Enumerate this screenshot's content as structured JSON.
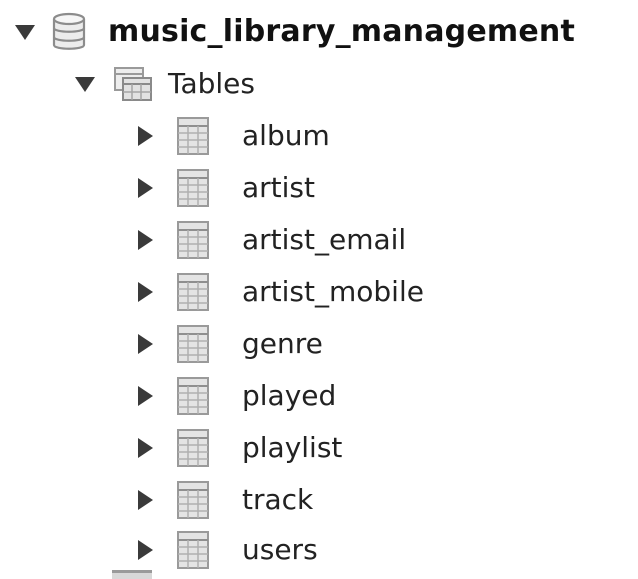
{
  "navigator": {
    "schema": {
      "name": "music_library_management",
      "icon": "database-icon",
      "expanded": true
    },
    "tables_folder": {
      "label": "Tables",
      "icon": "tables-folder-icon",
      "expanded": true
    },
    "tables": [
      {
        "label": "album",
        "icon": "table-icon",
        "expanded": false
      },
      {
        "label": "artist",
        "icon": "table-icon",
        "expanded": false
      },
      {
        "label": "artist_email",
        "icon": "table-icon",
        "expanded": false
      },
      {
        "label": "artist_mobile",
        "icon": "table-icon",
        "expanded": false
      },
      {
        "label": "genre",
        "icon": "table-icon",
        "expanded": false
      },
      {
        "label": "played",
        "icon": "table-icon",
        "expanded": false
      },
      {
        "label": "playlist",
        "icon": "table-icon",
        "expanded": false
      },
      {
        "label": "track",
        "icon": "table-icon",
        "expanded": false
      },
      {
        "label": "users",
        "icon": "table-icon",
        "expanded": false
      }
    ],
    "colors": {
      "arrow": "#3a3a3a",
      "table_icon_fill": "#e4e4e4",
      "table_icon_line": "#9a9a9a",
      "database_icon": "#8c8c8c"
    }
  }
}
